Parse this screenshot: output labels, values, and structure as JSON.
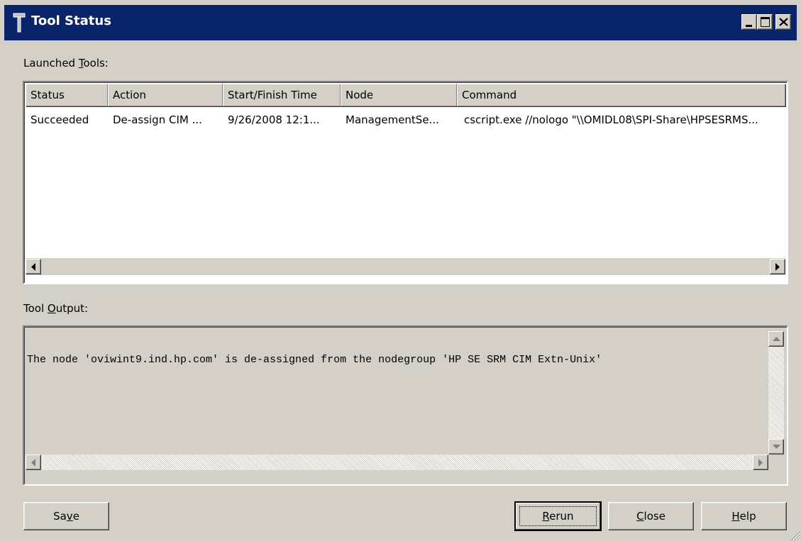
{
  "window": {
    "title": "Tool Status"
  },
  "launched_tools": {
    "label_prefix": "Launched ",
    "label_accel": "T",
    "label_suffix": "ools:",
    "columns": [
      "Status",
      "Action",
      "Start/Finish Time",
      "Node",
      "Command"
    ],
    "rows": [
      [
        "Succeeded",
        "De-assign CIM ...",
        "9/26/2008 12:1...",
        "ManagementSe...",
        "cscript.exe //nologo \"\\\\OMIDL08\\SPI-Share\\HPSESRMS..."
      ]
    ]
  },
  "tool_output": {
    "label_prefix": "Tool ",
    "label_accel": "O",
    "label_suffix": "utput:",
    "text": "The node 'oviwint9.ind.hp.com' is de-assigned from the nodegroup 'HP SE SRM CIM Extn-Unix'"
  },
  "buttons": {
    "save": {
      "pre": "Sa",
      "accel": "v",
      "post": "e"
    },
    "rerun": {
      "pre": "",
      "accel": "R",
      "post": "erun"
    },
    "close": {
      "pre": "",
      "accel": "C",
      "post": "lose"
    },
    "help": {
      "pre": "",
      "accel": "H",
      "post": "elp"
    }
  },
  "colors": {
    "titlebar": "#0a246a",
    "face": "#d4d0c8"
  }
}
